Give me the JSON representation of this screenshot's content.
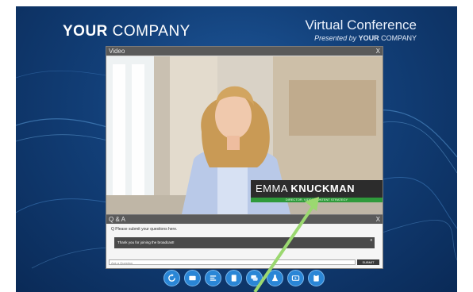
{
  "branding": {
    "company_bold": "YOUR",
    "company_rest": " COMPANY"
  },
  "conference": {
    "title": "Virtual Conference",
    "subtitle_prefix": "Presented by ",
    "subtitle_bold": "YOUR",
    "subtitle_rest": " COMPANY"
  },
  "video_panel": {
    "title": "Video",
    "close": "X"
  },
  "lower_third": {
    "first_name": "EMMA",
    "last_name": "KNUCKMAN",
    "role": "DIRECTOR, VIDEO CONTENT STRATEGY"
  },
  "qa_panel": {
    "title": "Q & A",
    "close": "X",
    "prompt": "Please submit your questions here.",
    "message": "Thank you for joining the broadcast!",
    "message_close": "x",
    "input_placeholder": "Ask a Question",
    "submit_label": "SUBMIT"
  },
  "toolbar": {
    "buttons": [
      "refresh-icon",
      "slides-icon",
      "list-icon",
      "document-icon",
      "chat-icon",
      "flask-icon",
      "media-icon",
      "clipboard-icon"
    ]
  },
  "colors": {
    "accent_blue": "#2a86d6",
    "lower_third_green": "#2f9a3b",
    "arrow_green": "#9bd870"
  }
}
